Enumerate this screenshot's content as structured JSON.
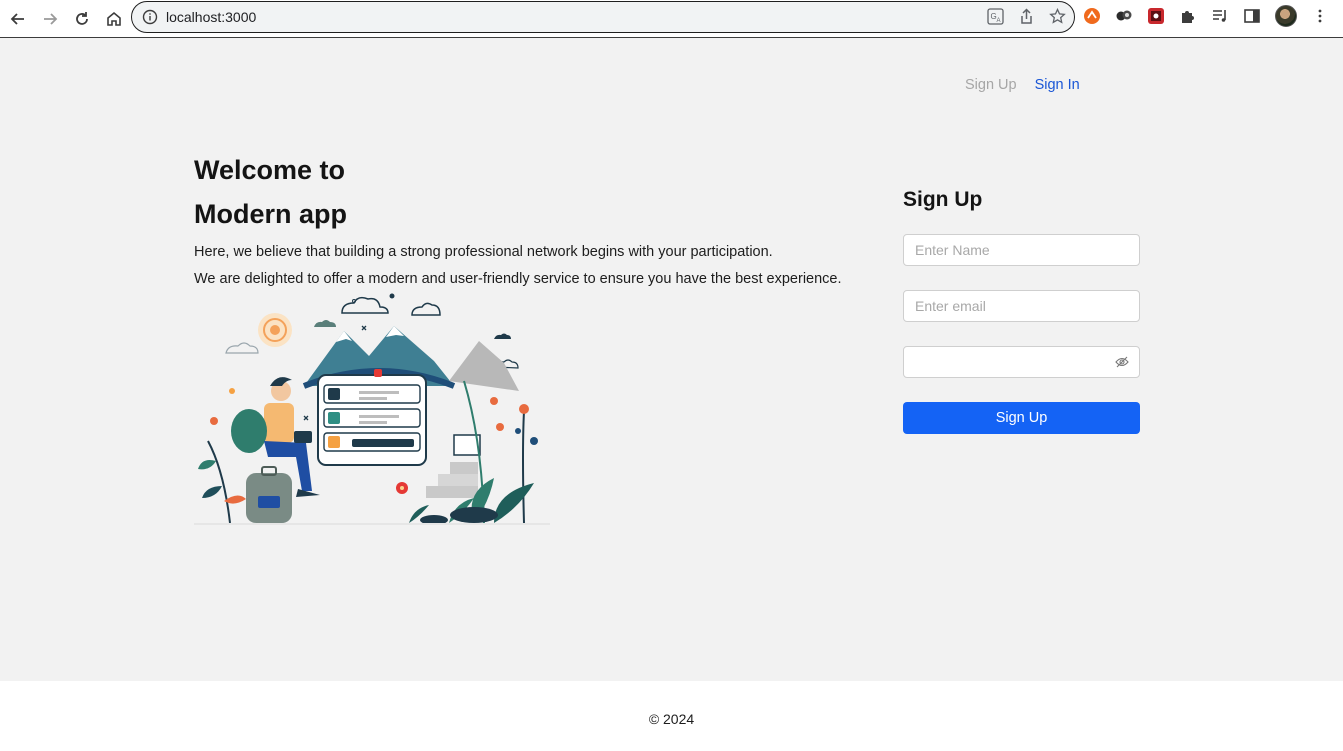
{
  "browser": {
    "url": "localhost:3000",
    "icons": [
      "back-icon",
      "forward-icon",
      "reload-icon",
      "home-icon",
      "info-icon",
      "translate-icon",
      "share-icon",
      "bookmark-star-icon",
      "extension-icon",
      "media-icon",
      "side-panel-icon",
      "menu-icon"
    ]
  },
  "nav": {
    "signup": "Sign Up",
    "signin": "Sign In"
  },
  "hero": {
    "title_line1": "Welcome to",
    "title_line2": "Modern app",
    "paragraph1": "Here, we believe that building a strong professional network begins with your participation.",
    "paragraph2": "We are delighted to offer a modern and user-friendly service to ensure you have the best experience."
  },
  "form": {
    "title": "Sign Up",
    "name_placeholder": "Enter Name",
    "email_placeholder": "Enter email",
    "password_value": "",
    "submit_label": "Sign Up"
  },
  "footer": {
    "copyright": "© 2024"
  },
  "colors": {
    "primary": "#1463f5",
    "link_active": "#1a56d6",
    "link_muted": "#a6a6a6",
    "background": "#f2f2f2"
  }
}
